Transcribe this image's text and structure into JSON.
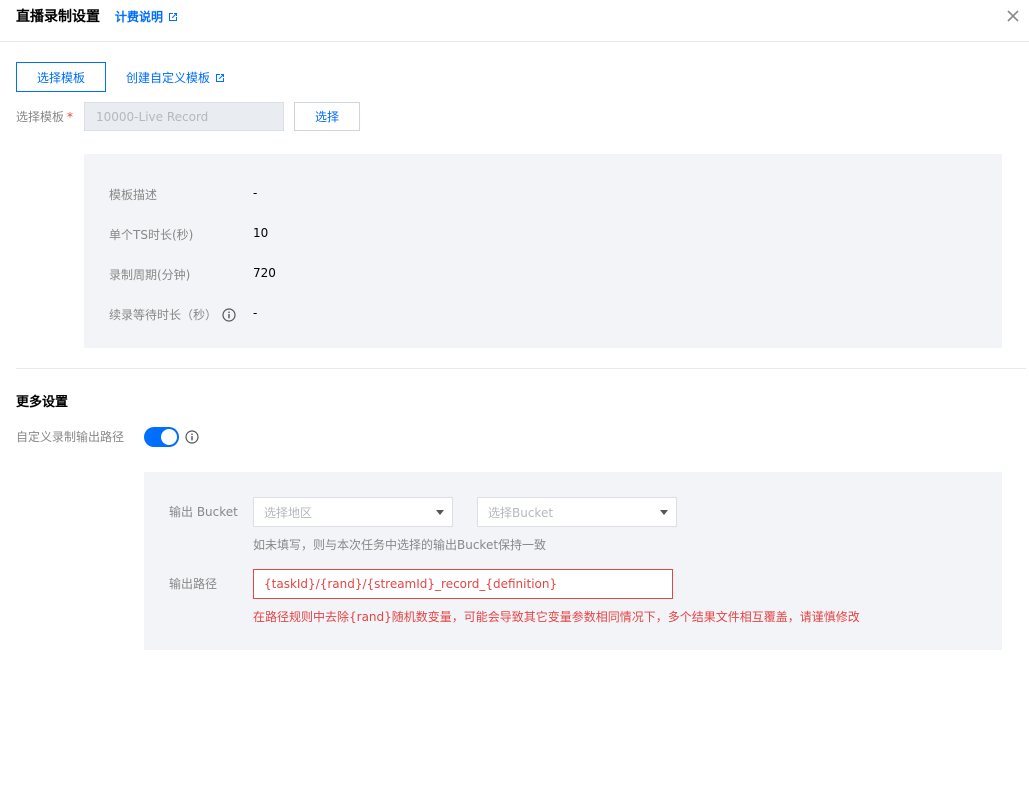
{
  "header": {
    "title": "直播录制设置",
    "billing_link": "计费说明"
  },
  "template_actions": {
    "select_template_button": "选择模板",
    "create_custom_template_link": "创建自定义模板"
  },
  "template_field": {
    "label": "选择模板",
    "required_mark": "*",
    "placeholder": "10000-Live Record",
    "select_button": "选择"
  },
  "template_details": [
    {
      "label": "模板描述",
      "value": "-",
      "has_info": false
    },
    {
      "label": "单个TS时长(秒)",
      "value": "10",
      "has_info": false
    },
    {
      "label": "录制周期(分钟)",
      "value": "720",
      "has_info": false
    },
    {
      "label": "续录等待时长（秒）",
      "value": "-",
      "has_info": true
    }
  ],
  "more_settings": {
    "title": "更多设置",
    "custom_path_label": "自定义录制输出路径",
    "custom_path_enabled": true
  },
  "output": {
    "bucket_label": "输出 Bucket",
    "region_placeholder": "选择地区",
    "bucket_placeholder": "选择Bucket",
    "bucket_hint": "如未填写，则与本次任务中选择的输出Bucket保持一致",
    "path_label": "输出路径",
    "path_value": "{taskId}/{rand}/{streamId}_record_{definition}",
    "path_error": "在路径规则中去除{rand}随机数变量，可能会导致其它变量参数相同情况下，多个结果文件相互覆盖，请谨慎修改"
  },
  "colors": {
    "accent": "#006eff",
    "error": "#e54545",
    "panel_bg": "#f3f4f7"
  }
}
